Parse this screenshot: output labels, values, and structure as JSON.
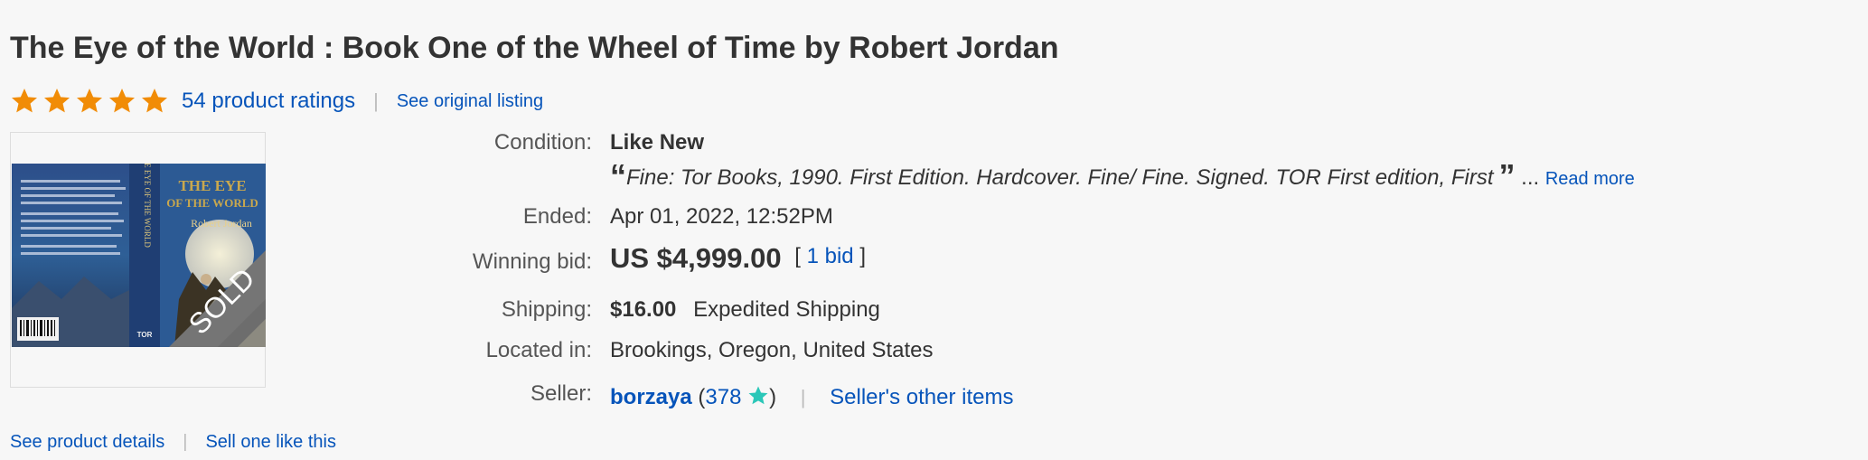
{
  "listing": {
    "title": "The Eye of the World : Book One of the Wheel of Time by Robert Jordan",
    "ratings_label": "54 product ratings",
    "see_original": "See original listing",
    "stars": 5,
    "star_color": "#f18c06"
  },
  "image": {
    "badge": "SOLD",
    "cover_title": "THE EYE OF THE WORLD",
    "cover_author": "Robert Jordan",
    "cover_publisher": "TOR"
  },
  "details": {
    "condition_label": "Condition:",
    "condition_value": "Like New",
    "description_quote": "Fine: Tor Books, 1990. First Edition. Hardcover. Fine/ Fine. Signed. TOR First edition, First",
    "open_quote": "“",
    "close_quote": "”",
    "ellipsis": "...",
    "read_more": "Read more",
    "ended_label": "Ended:",
    "ended_date": "Apr 01, 2022",
    "ended_time": ", 12:52PM",
    "winning_bid_label": "Winning bid:",
    "winning_bid_value": "US $4,999.00",
    "bids_open": "[",
    "bids_link": "1 bid",
    "bids_close": "]",
    "shipping_label": "Shipping:",
    "shipping_cost": "$16.00",
    "shipping_method": "Expedited Shipping",
    "located_label": "Located in:",
    "located_value": "Brookings, Oregon, United States",
    "seller_label": "Seller:",
    "seller_name": "borzaya",
    "seller_open": "(",
    "seller_score": "378",
    "seller_close": ")",
    "seller_other": "Seller's other items",
    "seller_star_color": "#2bc7b8"
  },
  "footer": {
    "product_details": "See product details",
    "sell_one": "Sell one like this"
  }
}
